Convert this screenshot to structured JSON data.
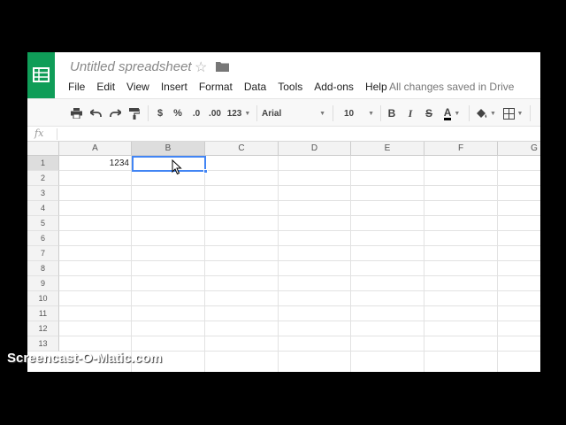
{
  "document": {
    "title": "Untitled spreadsheet"
  },
  "menu": {
    "items": [
      "File",
      "Edit",
      "View",
      "Insert",
      "Format",
      "Data",
      "Tools",
      "Add-ons",
      "Help"
    ],
    "save_status": "All changes saved in Drive"
  },
  "toolbar": {
    "currency": "$",
    "percent": "%",
    "decrease_decimal": ".0",
    "increase_decimal": ".00",
    "more_formats": "123",
    "font_family": "Arial",
    "font_size": "10",
    "bold": "B",
    "italic": "I",
    "strikethrough": "S",
    "text_color": "A",
    "text_color_hex": "#000000"
  },
  "formula_bar": {
    "fx_label": "fx",
    "value": ""
  },
  "sheet": {
    "columns": [
      "A",
      "B",
      "C",
      "D",
      "E",
      "F",
      "G"
    ],
    "rows": [
      "1",
      "2",
      "3",
      "4",
      "5",
      "6",
      "7",
      "8",
      "9",
      "10",
      "11",
      "12",
      "13"
    ],
    "selected_cell": "B1",
    "cells": {
      "A1": "1234",
      "B1": ""
    }
  },
  "colors": {
    "brand": "#0f9d58",
    "selection": "#4285f4"
  },
  "watermark": "Screencast-O-Matic.com"
}
